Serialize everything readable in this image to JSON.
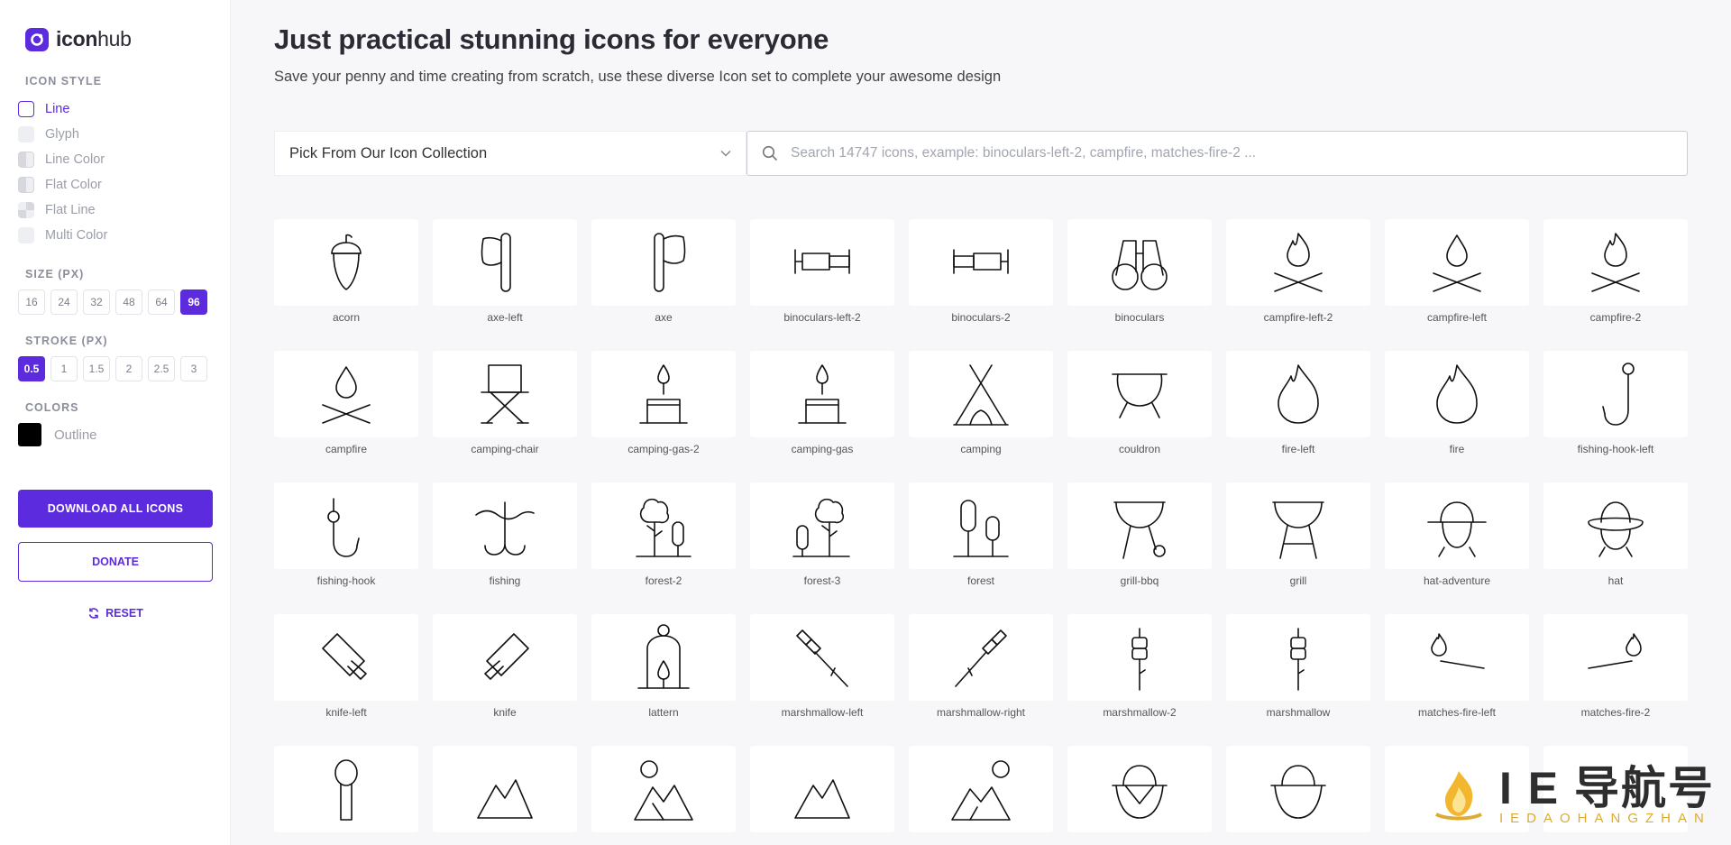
{
  "brand": {
    "name_bold": "icon",
    "name_rest": "hub"
  },
  "sidebar": {
    "icon_style_title": "ICON STYLE",
    "styles": [
      {
        "label": "Line",
        "swatch": "line",
        "active": true
      },
      {
        "label": "Glyph",
        "swatch": "pale",
        "active": false
      },
      {
        "label": "Line Color",
        "swatch": "half",
        "active": false
      },
      {
        "label": "Flat Color",
        "swatch": "half",
        "active": false
      },
      {
        "label": "Flat Line",
        "swatch": "quad",
        "active": false
      },
      {
        "label": "Multi Color",
        "swatch": "pale",
        "active": false
      }
    ],
    "size_title": "SIZE (PX)",
    "sizes": [
      "16",
      "24",
      "32",
      "48",
      "64",
      "96"
    ],
    "size_active": "96",
    "stroke_title": "STROKE (PX)",
    "strokes": [
      "0.5",
      "1",
      "1.5",
      "2",
      "2.5",
      "3"
    ],
    "stroke_active": "0.5",
    "colors_title": "COLORS",
    "color_label": "Outline",
    "color_value": "#000000",
    "download_label": "DOWNLOAD ALL ICONS",
    "donate_label": "DONATE",
    "reset_label": "RESET"
  },
  "main": {
    "title": "Just practical stunning icons for everyone",
    "subtitle": "Save your penny and time creating from scratch, use these diverse Icon set to complete your awesome design",
    "collection_select": "Pick From Our Icon Collection",
    "search_placeholder": "Search 14747 icons, example: binoculars-left-2, campfire, matches-fire-2 ..."
  },
  "icons": [
    {
      "label": "acorn",
      "glyph": "acorn"
    },
    {
      "label": "axe-left",
      "glyph": "axe-left"
    },
    {
      "label": "axe",
      "glyph": "axe"
    },
    {
      "label": "binoculars-left-2",
      "glyph": "binoc-side"
    },
    {
      "label": "binoculars-2",
      "glyph": "binoc-side-r"
    },
    {
      "label": "binoculars",
      "glyph": "binoculars"
    },
    {
      "label": "campfire-left-2",
      "glyph": "campfire-flame"
    },
    {
      "label": "campfire-left",
      "glyph": "campfire-drop"
    },
    {
      "label": "campfire-2",
      "glyph": "campfire-flame"
    },
    {
      "label": "campfire",
      "glyph": "campfire-drop"
    },
    {
      "label": "camping-chair",
      "glyph": "chair"
    },
    {
      "label": "camping-gas-2",
      "glyph": "gas"
    },
    {
      "label": "camping-gas",
      "glyph": "gas"
    },
    {
      "label": "camping",
      "glyph": "tent"
    },
    {
      "label": "couldron",
      "glyph": "cauldron"
    },
    {
      "label": "fire-left",
      "glyph": "fire"
    },
    {
      "label": "fire",
      "glyph": "fire"
    },
    {
      "label": "fishing-hook-left",
      "glyph": "hook-left"
    },
    {
      "label": "fishing-hook",
      "glyph": "hook"
    },
    {
      "label": "fishing",
      "glyph": "fishing"
    },
    {
      "label": "forest-2",
      "glyph": "forest-2"
    },
    {
      "label": "forest-3",
      "glyph": "forest-3"
    },
    {
      "label": "forest",
      "glyph": "forest"
    },
    {
      "label": "grill-bbq",
      "glyph": "grill-bbq"
    },
    {
      "label": "grill",
      "glyph": "grill"
    },
    {
      "label": "hat-adventure",
      "glyph": "hat-adventure"
    },
    {
      "label": "hat",
      "glyph": "hat"
    },
    {
      "label": "knife-left",
      "glyph": "knife-left"
    },
    {
      "label": "knife",
      "glyph": "knife"
    },
    {
      "label": "lattern",
      "glyph": "lantern"
    },
    {
      "label": "marshmallow-left",
      "glyph": "mallow-left"
    },
    {
      "label": "marshmallow-right",
      "glyph": "mallow-right"
    },
    {
      "label": "marshmallow-2",
      "glyph": "mallow-stick"
    },
    {
      "label": "marshmallow",
      "glyph": "mallow-stick"
    },
    {
      "label": "matches-fire-left",
      "glyph": "match-left"
    },
    {
      "label": "matches-fire-2",
      "glyph": "match-right"
    },
    {
      "label": "",
      "glyph": "spoon"
    },
    {
      "label": "",
      "glyph": "mountain"
    },
    {
      "label": "",
      "glyph": "mountain-sun-left"
    },
    {
      "label": "",
      "glyph": "mountain"
    },
    {
      "label": "",
      "glyph": "mountain-sun-right"
    },
    {
      "label": "",
      "glyph": "basket-v"
    },
    {
      "label": "",
      "glyph": "basket"
    },
    {
      "label": "",
      "glyph": "blank"
    },
    {
      "label": "",
      "glyph": "blank"
    }
  ],
  "watermark": {
    "main": "I E 导航号",
    "sub": "IEDAOHANGZHAN"
  },
  "colors": {
    "accent": "#5b2bdd",
    "sidebar_bg": "#ffffff",
    "page_bg": "#f7f7f9"
  }
}
